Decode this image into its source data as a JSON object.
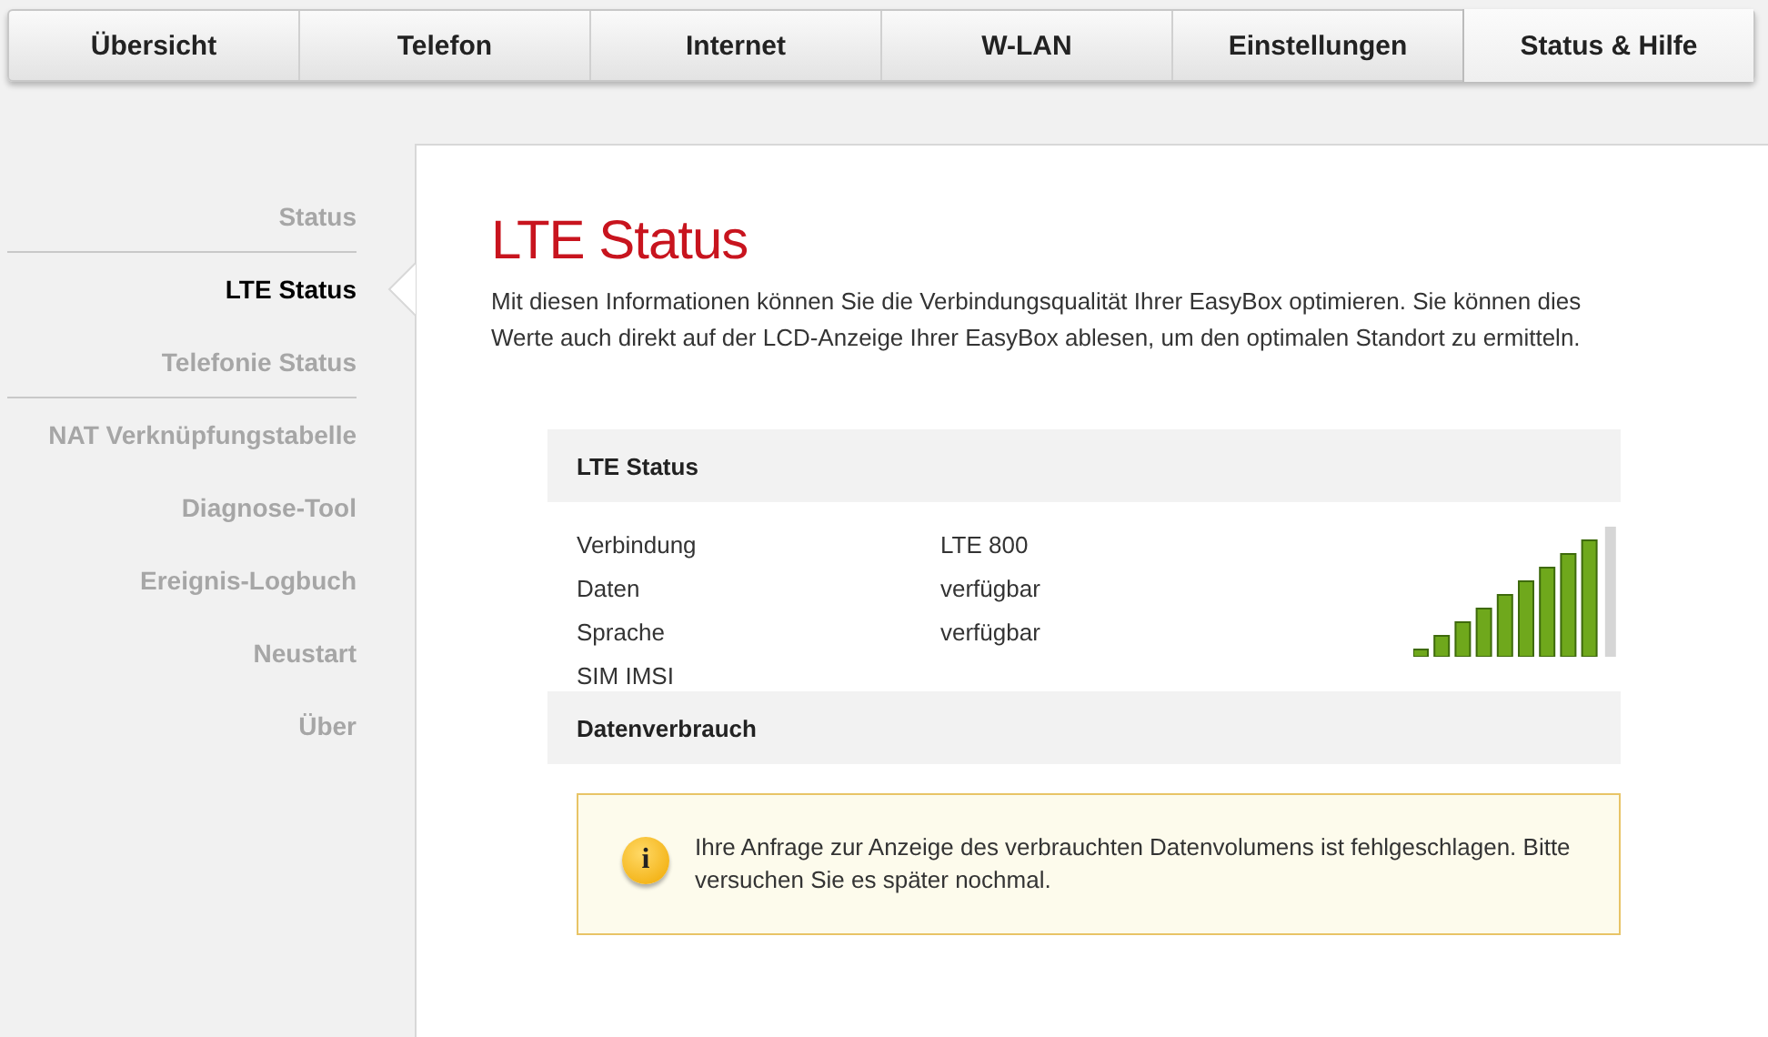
{
  "tabs": [
    {
      "label": "Übersicht",
      "selected": false
    },
    {
      "label": "Telefon",
      "selected": false
    },
    {
      "label": "Internet",
      "selected": false
    },
    {
      "label": "W-LAN",
      "selected": false
    },
    {
      "label": "Einstellungen",
      "selected": false
    },
    {
      "label": "Status & Hilfe",
      "selected": true
    }
  ],
  "sidebar": {
    "items": [
      {
        "label": "Status",
        "selected": false,
        "separator_below": true
      },
      {
        "label": "LTE Status",
        "selected": true,
        "separator_below": false
      },
      {
        "label": "Telefonie Status",
        "selected": false,
        "separator_below": true
      },
      {
        "label": "NAT Verknüpfungstabelle",
        "selected": false,
        "separator_below": false
      },
      {
        "label": "Diagnose-Tool",
        "selected": false,
        "separator_below": false
      },
      {
        "label": "Ereignis-Logbuch",
        "selected": false,
        "separator_below": false
      },
      {
        "label": "Neustart",
        "selected": false,
        "separator_below": false
      },
      {
        "label": "Über",
        "selected": false,
        "separator_below": false
      }
    ]
  },
  "page": {
    "title": "LTE Status",
    "description": "Mit diesen Informationen können Sie die Verbindungsqualität Ihrer EasyBox optimieren. Sie können dies Werte auch direkt auf der LCD-Anzeige Ihrer EasyBox ablesen, um den optimalen Standort zu ermitteln."
  },
  "lte_section": {
    "heading": "LTE Status",
    "rows": [
      {
        "label": "Verbindung",
        "value": "LTE 800"
      },
      {
        "label": "Daten",
        "value": "verfügbar"
      },
      {
        "label": "Sprache",
        "value": "verfügbar"
      },
      {
        "label": "SIM IMSI"
      }
    ]
  },
  "usage_section": {
    "heading": "Datenverbrauch",
    "notice": {
      "icon": "i",
      "message": "Ihre Anfrage zur Anzeige des verbrauchten Datenvolumens ist fehlgeschlagen. Bitte versuchen Sie es später nochmal."
    }
  }
}
